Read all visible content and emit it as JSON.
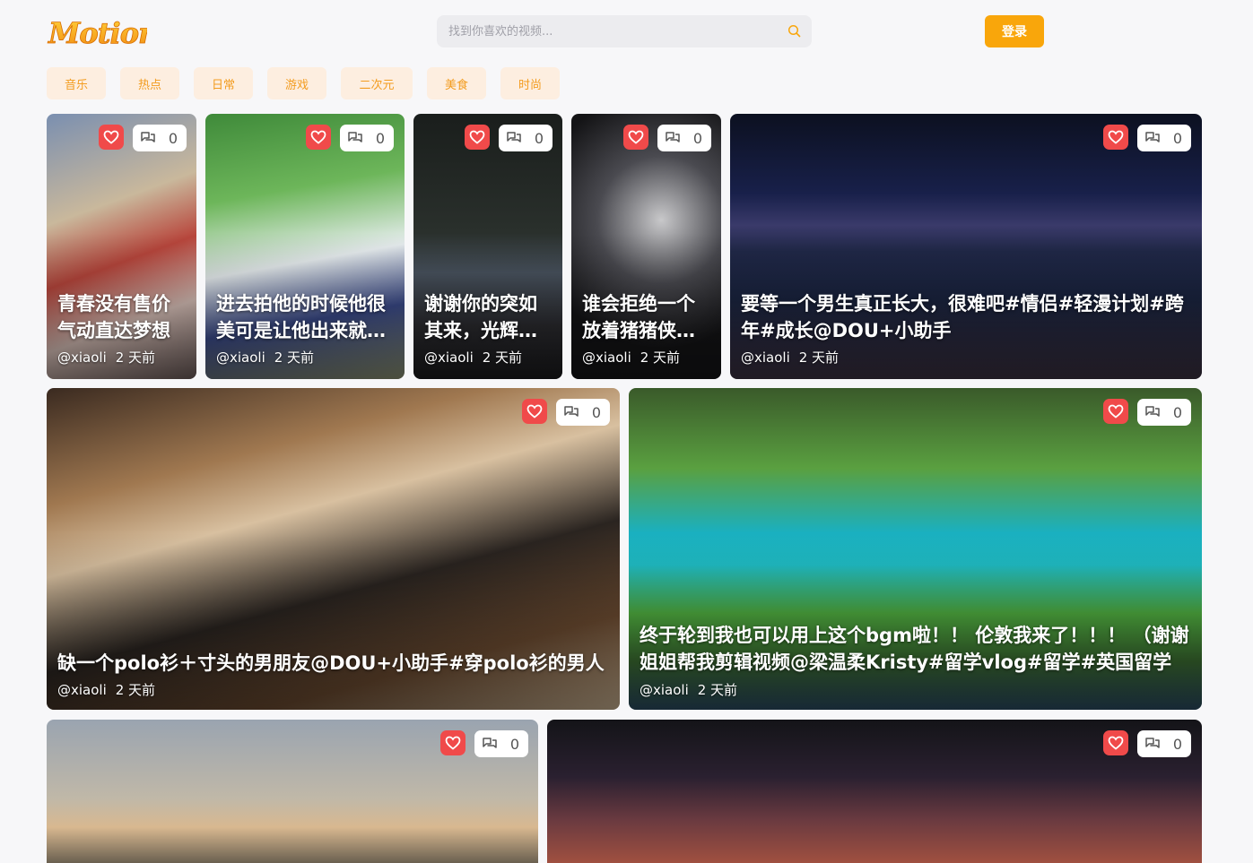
{
  "header": {
    "logo_text": "Motion",
    "search_placeholder": "找到你喜欢的视频...",
    "login_label": "登录"
  },
  "categories": [
    "音乐",
    "热点",
    "日常",
    "游戏",
    "二次元",
    "美食",
    "时尚"
  ],
  "colors": {
    "accent": "#f9a60b",
    "category_bg": "#fdeee0",
    "category_text": "#f39c1f",
    "like": "#f04a4a"
  },
  "videos": [
    {
      "title": "青春没有售价 气动直达梦想",
      "author": "@xiaoli",
      "time": "2 天前",
      "comments": "0"
    },
    {
      "title": "进去拍他的时候他很美可是让他出来就不肯了",
      "author": "@xiaoli",
      "time": "2 天前",
      "comments": "0"
    },
    {
      "title": "谢谢你的突如其来，光辉岁月",
      "author": "@xiaoli",
      "time": "2 天前",
      "comments": "0"
    },
    {
      "title": "谁会拒绝一个放着猪猪侠的车",
      "author": "@xiaoli",
      "time": "2 天前",
      "comments": "0"
    },
    {
      "title": "要等一个男生真正长大，很难吧#情侣#轻漫计划#跨年#成长@DOU+小助手",
      "author": "@xiaoli",
      "time": "2 天前",
      "comments": "0"
    },
    {
      "title": "缺一个polo衫＋寸头的男朋友@DOU+小助手#穿polo衫的男人",
      "author": "@xiaoli",
      "time": "2 天前",
      "comments": "0"
    },
    {
      "title": "终于轮到我也可以用上这个bgm啦！！ 伦敦我来了！！！ （谢谢姐姐帮我剪辑视频@梁温柔Kristy#留学vlog#留学#英国留学",
      "author": "@xiaoli",
      "time": "2 天前",
      "comments": "0"
    },
    {
      "title": "",
      "author": "",
      "time": "",
      "comments": "0"
    },
    {
      "title": "",
      "author": "",
      "time": "",
      "comments": "0"
    }
  ]
}
